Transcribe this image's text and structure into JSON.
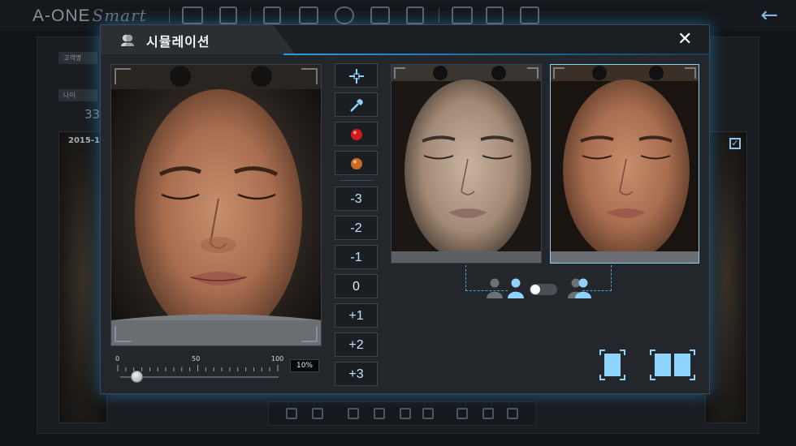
{
  "app": {
    "brand": "A-ONE",
    "brand_suffix": "Smart"
  },
  "background": {
    "tag_customer": "고객명",
    "tag_age": "나이",
    "age_value": "33",
    "date_value": "2015-1"
  },
  "modal": {
    "title": "시뮬레이션",
    "close_label": "✕"
  },
  "tools": {
    "crosshair_icon": "crosshair-icon",
    "eyedropper_icon": "eyedropper-icon",
    "red_color": "#d11a1a",
    "orange_color": "#c96a22",
    "levels": [
      "-3",
      "-2",
      "-1",
      "0",
      "+1",
      "+2",
      "+3"
    ]
  },
  "slider": {
    "min_label": "0",
    "mid_label": "50",
    "max_label": "100",
    "value_percent": 10,
    "readout": "10%"
  },
  "colors": {
    "accent": "#2f9ae0",
    "selected_border": "#8ad0f5",
    "icon_blue": "#8fd3ff"
  }
}
